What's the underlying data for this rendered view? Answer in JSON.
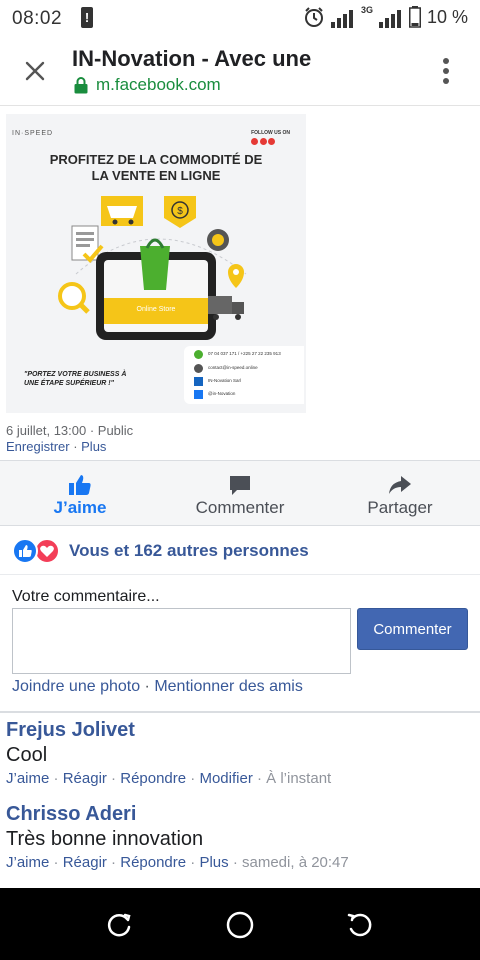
{
  "status_bar": {
    "time": "08:02",
    "alert_glyph": "!",
    "network": "3G",
    "battery": "10 %",
    "icons": [
      "alert-icon",
      "alarm-icon",
      "signal-icon",
      "battery-icon"
    ]
  },
  "browser": {
    "title": "IN-Novation - Avec une",
    "url": "m.facebook.com",
    "icons": [
      "close-icon",
      "lock-icon",
      "more-icon"
    ]
  },
  "post_image": {
    "brand": "IN·SPEED",
    "follow_text": "FOLLOW US ON",
    "headline_line1": "PROFITEZ DE LA COMMODITÉ DE",
    "headline_line2": "LA VENTE EN LIGNE",
    "store_label": "Online Store",
    "slogan": "\"PORTEZ VOTRE BUSINESS À UNE ÉTAPE SUPÉRIEUR !\"",
    "contact_phone": "07 04 037 171 / +225 27 22 235 913",
    "contact_email": "contact@in-speed.online",
    "contact_linkedin": "IN-Novation Sarl",
    "contact_social": "@in-Novation"
  },
  "post": {
    "meta": "6 juillet, 13:00 · Public",
    "save_label": "Enregistrer",
    "more_label": "Plus",
    "separator": " · "
  },
  "actions": {
    "like": "J’aime",
    "comment": "Commenter",
    "share": "Partager"
  },
  "reactions": {
    "text": "Vous et 162 autres personnes"
  },
  "composer": {
    "label": "Votre commentaire...",
    "value": "",
    "submit": "Commenter",
    "attach_photo": "Joindre une photo",
    "mention": "Mentionner des amis",
    "separator": " · "
  },
  "comments": [
    {
      "author": "Frejus Jolivet",
      "text": "Cool",
      "like": "J’aime",
      "react": "Réagir",
      "reply": "Répondre",
      "extra": "Modifier",
      "time": "À l’instant"
    },
    {
      "author": "Chrisso Aderi",
      "text": "Très bonne innovation",
      "like": "J’aime",
      "react": "Réagir",
      "reply": "Répondre",
      "extra": "Plus",
      "time": "samedi, à 20:47"
    }
  ],
  "colors": {
    "facebook_blue": "#1877f2",
    "link_blue": "#385898",
    "button_blue": "#4267b2",
    "lock_green": "#1a8d3e",
    "love_red": "#f33e58",
    "promo_yellow": "#f5c518",
    "promo_green": "#4caf2f"
  }
}
